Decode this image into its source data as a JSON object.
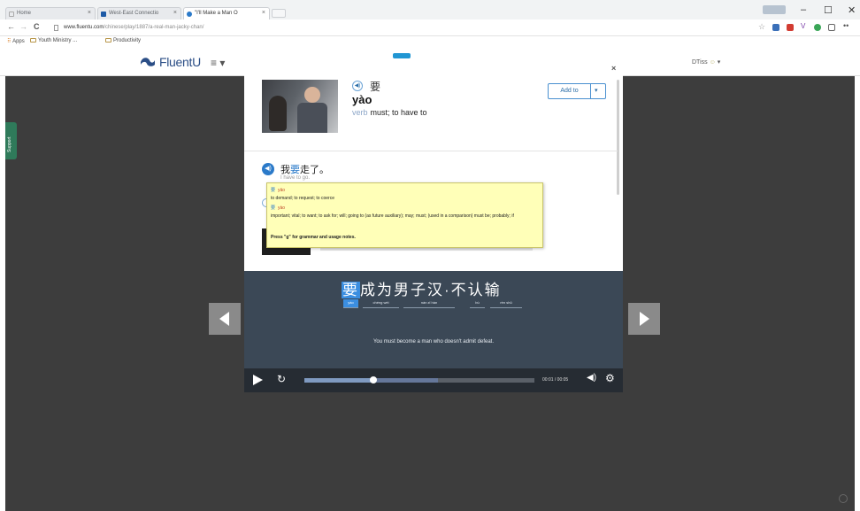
{
  "browser": {
    "tabs": [
      {
        "label": "Home",
        "favicon_color": "#ffffff"
      },
      {
        "label": "West-East Connectio",
        "favicon_color": "#1d5aa6"
      },
      {
        "label": "\"I'll Make a Man O",
        "favicon_color": "#2b7ac9"
      }
    ],
    "url_host": "www.fluentu.com",
    "url_path": "/chinese/play/1887/a-real-man-jacky-chan/",
    "bookmarks": [
      "Apps",
      "Youth Ministry ...",
      "Productivity"
    ],
    "window_buttons": [
      "–",
      "☐",
      "✕"
    ],
    "nav": {
      "back": "←",
      "forward": "→",
      "reload": "C"
    }
  },
  "site": {
    "logo": "FluentU",
    "menu_icon": "≡",
    "user_menu": "DTiss"
  },
  "support": {
    "label": "Support"
  },
  "modal": {
    "close": "×",
    "word": {
      "hanzi": "要",
      "pinyin": "yào",
      "pos": "verb",
      "definition": "must; to have to"
    },
    "add_to": {
      "label": "Add to",
      "caret": "▾"
    },
    "example": {
      "pre": "我",
      "hl": "要",
      "post": "走了。",
      "translation": "I have to go."
    },
    "tooltip": {
      "line1_zh": "要",
      "line1_py": "yāo",
      "line2": "to demand; to request; to coerce",
      "line3_zh": "要",
      "line3_py": "yào",
      "line4": "important; vital; to want; to ask for; will; going to (as future auxiliary); may; must; (used in a comparison) must be; probably; if",
      "line5": "Press \"g\" for grammar and usage notes."
    }
  },
  "video": {
    "subtitle": {
      "hl": "要",
      "rest": "成为男子汉·不认输",
      "pinyin": [
        "yào",
        "chéng wéi",
        "nán zǐ hàn",
        "bù",
        "rèn shū"
      ],
      "english": "You must become a man who doesn't admit defeat."
    },
    "controls": {
      "time": "00:01 / 00:05",
      "progress": 0.3,
      "buffered": 0.58,
      "play_icon": "play-icon",
      "replay_symbol": "↻",
      "volume_symbol": "◀)",
      "settings_symbol": "⚙"
    }
  },
  "colors": {
    "accent": "#2b7ac9",
    "dark_bg": "#3d3d3d",
    "tooltip_bg": "#ffffb8"
  }
}
